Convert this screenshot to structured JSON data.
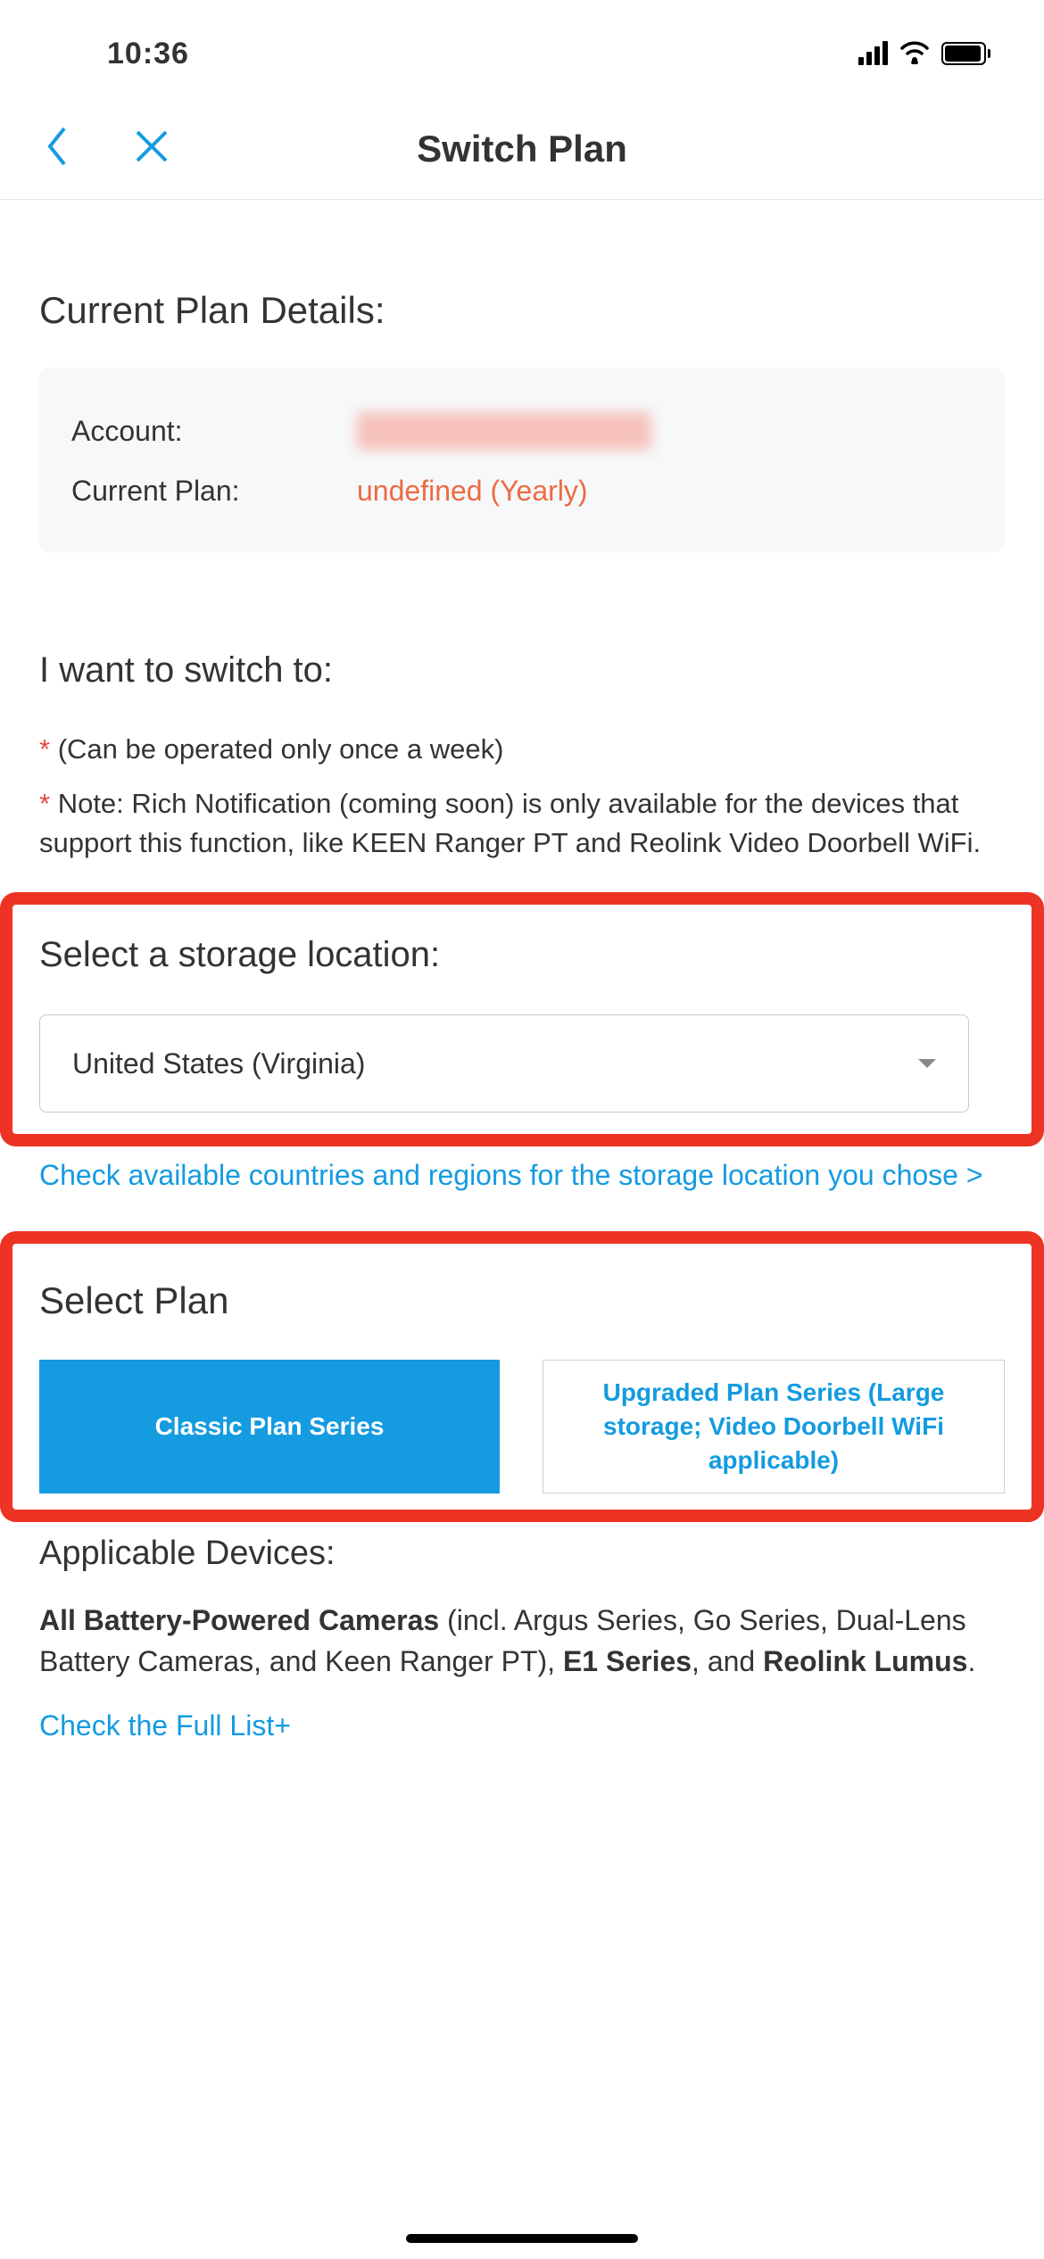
{
  "status": {
    "time": "10:36"
  },
  "nav": {
    "title": "Switch Plan"
  },
  "details": {
    "heading": "Current Plan Details:",
    "account_label": "Account:",
    "plan_label": "Current Plan:",
    "plan_value": "undefined (Yearly)"
  },
  "switch": {
    "heading": "I want to switch to:",
    "note1": " (Can be operated only once a week)",
    "note2": " Note: Rich Notification (coming soon) is only available for the devices that support this function, like KEEN Ranger PT and Reolink Video Doorbell WiFi."
  },
  "storage": {
    "heading": "Select a storage location:",
    "selected": "United States (Virginia)",
    "link": "Check available countries and regions for the storage location you chose  >"
  },
  "plan": {
    "heading": "Select Plan",
    "tab1": "Classic Plan Series",
    "tab2": "Upgraded Plan Series (Large storage; Video Doorbell WiFi applicable)"
  },
  "devices": {
    "heading": "Applicable Devices:",
    "b1": "All Battery-Powered Cameras",
    "t1": " (incl. Argus Series, Go Series, Dual-Lens Battery Cameras, and Keen Ranger PT), ",
    "b2": "E1 Series",
    "t2": ", and ",
    "b3": "Reolink Lumus",
    "t3": ".",
    "link": "Check the Full List+"
  }
}
